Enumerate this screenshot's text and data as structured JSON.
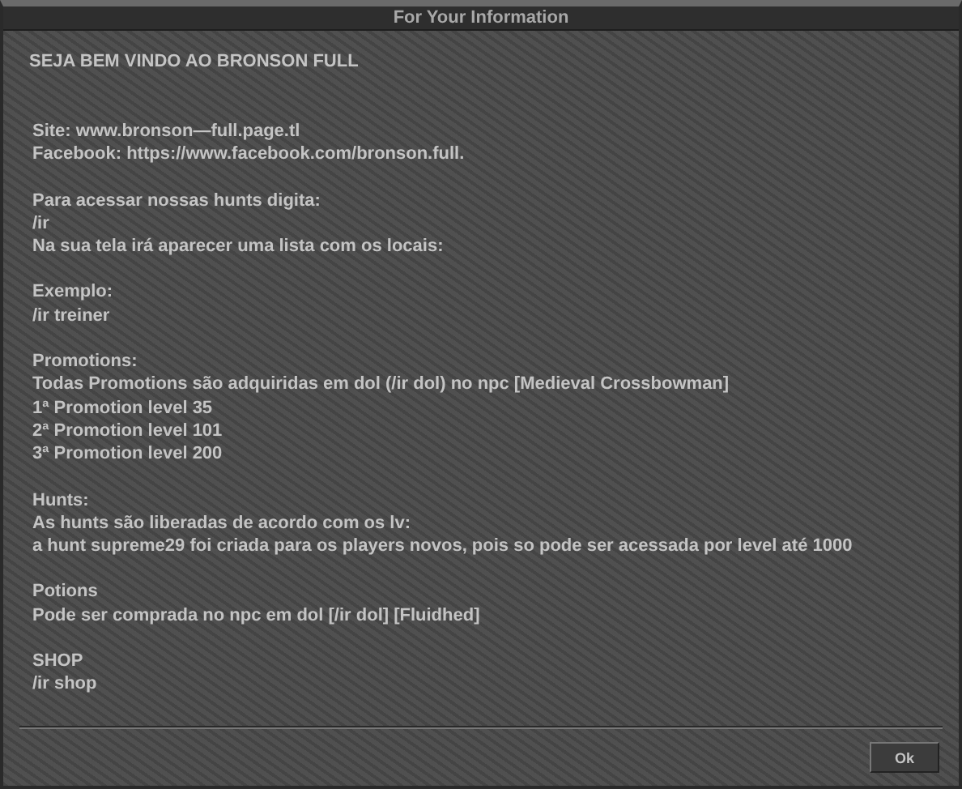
{
  "window": {
    "title": "For Your Information"
  },
  "heading": "SEJA BEM VINDO AO BRONSON FULL",
  "paragraphs": [
    [
      "Site: www.bronson—full.page.tl",
      "Facebook: https://www.facebook.com/bronson.full."
    ],
    [
      "Para acessar nossas hunts digita:",
      "/ir",
      "Na sua tela irá aparecer uma lista com os locais:"
    ],
    [
      "Exemplo:",
      "/ir treiner"
    ],
    [
      "Promotions:",
      "Todas Promotions são adquiridas em dol (/ir dol) no npc [Medieval Crossbowman]",
      "1ª Promotion level 35",
      "2ª Promotion level 101",
      "3ª Promotion level 200"
    ],
    [
      "Hunts:",
      "As hunts são liberadas de acordo com os lv:",
      "a hunt supreme29 foi criada para os players novos, pois so pode ser acessada por level até 1000"
    ],
    [
      "Potions",
      "Pode ser comprada no npc em dol [/ir dol] [Fluidhed]"
    ],
    [
      "SHOP",
      "/ir shop"
    ]
  ],
  "buttons": [
    "Ok"
  ]
}
